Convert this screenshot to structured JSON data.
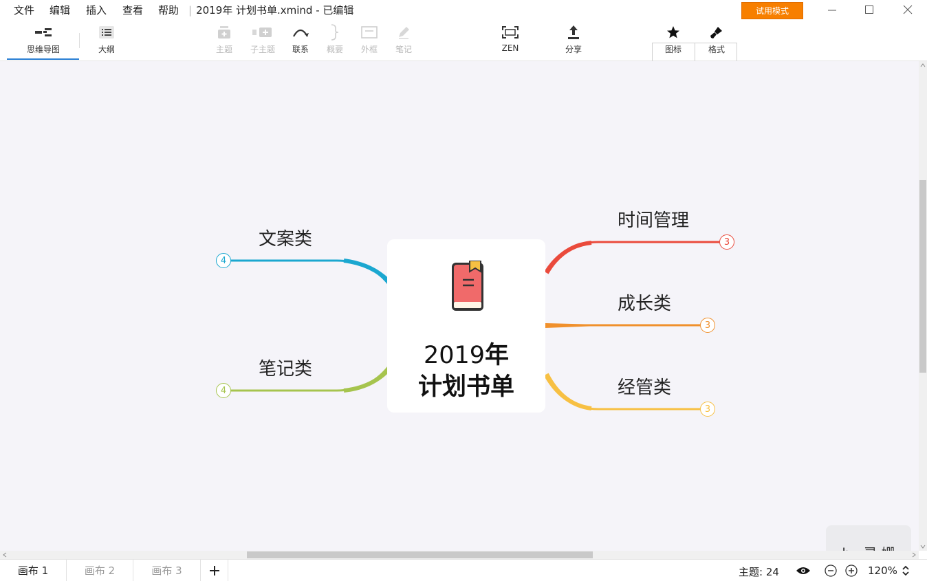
{
  "menu": {
    "items": [
      "文件",
      "编辑",
      "插入",
      "查看",
      "帮助"
    ],
    "doc_title": "2019年 计划书单.xmind - 已编辑",
    "trial_button": "试用模式"
  },
  "toolbar": {
    "mindmap": "思维导图",
    "outline": "大纲",
    "topic": "主题",
    "subtopic": "子主题",
    "relationship": "联系",
    "summary": "概要",
    "boundary": "外框",
    "note": "笔记",
    "zen": "ZEN",
    "share": "分享",
    "icon_panel": "图标",
    "format_panel": "格式"
  },
  "mindmap": {
    "central": {
      "line1_plain": "2019",
      "line1_bold": "年",
      "line2": "计划书单"
    },
    "branches": [
      {
        "label": "文案类",
        "count": "4",
        "color": "#1ba7d0"
      },
      {
        "label": "笔记类",
        "count": "4",
        "color": "#a6c44e"
      },
      {
        "label": "时间管理",
        "count": "3",
        "color": "#ea4a3c"
      },
      {
        "label": "成长类",
        "count": "3",
        "color": "#f0902c"
      },
      {
        "label": "经管类",
        "count": "3",
        "color": "#f7c043"
      }
    ],
    "watermark": "by 灵 姗"
  },
  "statusbar": {
    "sheets": [
      "画布 1",
      "画布 2",
      "画布 3"
    ],
    "topic_count": "主题: 24",
    "zoom": "120%"
  }
}
